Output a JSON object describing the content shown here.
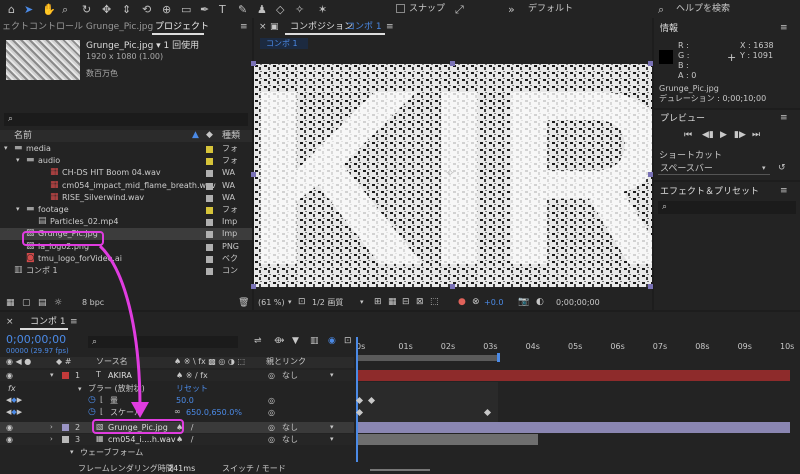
{
  "toolbar": {
    "snap": "スナップ",
    "workspace": "デフォルト",
    "search": "ヘルプを検索"
  },
  "left_tabs": {
    "effect_controls": "ェクトコントロール Grunge_Pic.jpg",
    "project": "プロジェクト"
  },
  "asset": {
    "name": "Grunge_Pic.jpg ▾ 1 回使用",
    "dims": "1920 x 1080 (1.00)",
    "colors": "数百万色"
  },
  "project": {
    "col_name": "名前",
    "col_type": "種類",
    "items": [
      {
        "name": "media",
        "type": "フォ",
        "color": "#d6c43a",
        "indent": 0,
        "kind": "folder"
      },
      {
        "name": "audio",
        "type": "フォ",
        "color": "#d6c43a",
        "indent": 1,
        "kind": "folder"
      },
      {
        "name": "CH-DS HIT Boom 04.wav",
        "type": "WA",
        "color": "#b0b0b0",
        "indent": 3,
        "kind": "audio"
      },
      {
        "name": "cm054_impact_mid_flame_breath.wav",
        "type": "WA",
        "color": "#b0b0b0",
        "indent": 3,
        "kind": "audio"
      },
      {
        "name": "RISE_Silverwind.wav",
        "type": "WA",
        "color": "#b0b0b0",
        "indent": 3,
        "kind": "audio"
      },
      {
        "name": "footage",
        "type": "フォ",
        "color": "#d6c43a",
        "indent": 1,
        "kind": "folder"
      },
      {
        "name": "Particles_02.mp4",
        "type": "Imp",
        "color": "#b0b0b0",
        "indent": 2,
        "kind": "video"
      },
      {
        "name": "Grunge_Pic.jpg",
        "type": "Imp",
        "color": "#b0b0b0",
        "indent": 1,
        "kind": "image"
      },
      {
        "name": "ia_logo2.png",
        "type": "PNG",
        "color": "#b0b0b0",
        "indent": 1,
        "kind": "image"
      },
      {
        "name": "tmu_logo_forVideo.ai",
        "type": "ベク",
        "color": "#b0b0b0",
        "indent": 1,
        "kind": "ai"
      },
      {
        "name": "コンポ 1",
        "type": "コン",
        "color": "#b0b0b0",
        "indent": 0,
        "kind": "comp"
      }
    ],
    "bpc": "8 bpc"
  },
  "comp": {
    "tab_label": "コンポジション",
    "tab_name": "コンポ 1",
    "sub_tab": "コンポ 1",
    "zoom": "(61 %)",
    "quality": "1/2 画質",
    "exposure": "+0.0",
    "timecode": "0;00;00;00"
  },
  "info": {
    "title": "情報",
    "r": "R :",
    "g": "G :",
    "b": "B :",
    "a": "A :  0",
    "x": "X : 1638",
    "y": "Y : 1091",
    "file": "Grunge_Pic.jpg",
    "duration": "デュレーション : 0;00;10;00"
  },
  "preview": {
    "title": "プレビュー",
    "shortcut_label": "ショートカット",
    "shortcut_value": "スペースバー"
  },
  "effects": {
    "title": "エフェクト＆プリセット"
  },
  "timeline": {
    "tab": "コンポ 1",
    "time": "0;00;00;00",
    "fps": "00000 (29.97 fps)",
    "col_source": "ソース名",
    "col_parent": "親とリンク",
    "ruler": [
      "0s",
      "01s",
      "02s",
      "03s",
      "04s",
      "05s",
      "06s",
      "07s",
      "08s",
      "09s",
      "10s"
    ],
    "layers": [
      {
        "num": "1",
        "name": "AKIRA",
        "color": "#c23a3a",
        "parent": "なし",
        "type": "T"
      },
      {
        "num": "2",
        "name": "Grunge_Pic.jpg",
        "color": "#9a94c4",
        "parent": "なし",
        "type": "img"
      },
      {
        "num": "3",
        "name": "cm054_i....h.wav",
        "color": "#b8b8b8",
        "parent": "なし",
        "type": "audio"
      }
    ],
    "blur_effect": "ブラー (放射状)",
    "reset": "リセット",
    "amount_label": "量",
    "amount_value": "50.0",
    "scale_label": "スケール",
    "scale_value": "650.0,650.0%",
    "waveform": "ウェーブフォーム",
    "render_time_label": "フレームレンダリング時間",
    "render_time": "241ms",
    "switch_mode": "スイッチ / モード"
  },
  "canvas": {
    "text": "KIR"
  }
}
